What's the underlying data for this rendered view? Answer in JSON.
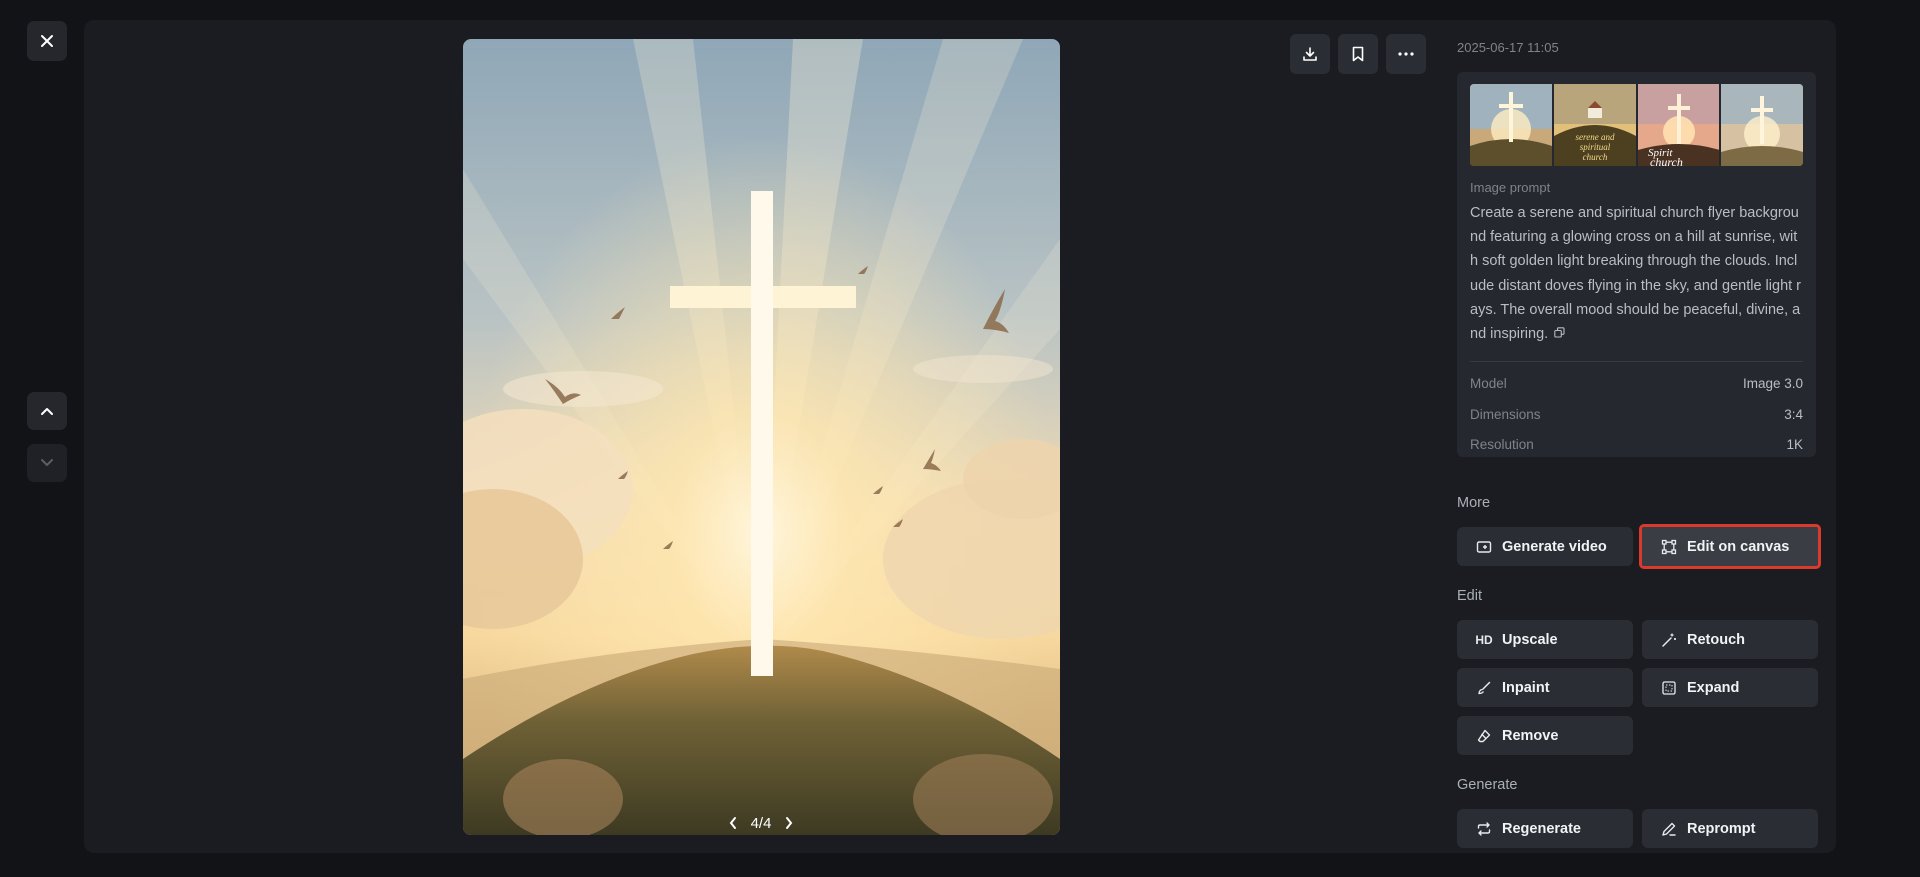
{
  "close": {
    "icon": "close-icon"
  },
  "nav": {
    "up_icon": "chevron-up-icon",
    "down_icon": "chevron-down-icon"
  },
  "viewer": {
    "pager": {
      "text": "4/4"
    },
    "thumb_texts": [
      "serene and spiritual church",
      "Spirit church"
    ]
  },
  "toolbar": {
    "download_icon": "download-icon",
    "bookmark_icon": "bookmark-icon",
    "more_icon": "more-icon"
  },
  "details": {
    "timestamp": "2025-06-17 11:05",
    "prompt_label": "Image prompt",
    "prompt_text": "Create a serene and spiritual church flyer background featuring a glowing cross on a hill at sunrise, with soft golden light breaking through the clouds. Include distant doves flying in the sky, and gentle light rays. The overall mood should be peaceful, divine, and inspiring.",
    "meta": [
      {
        "key": "Model",
        "value": "Image 3.0"
      },
      {
        "key": "Dimensions",
        "value": "3:4"
      },
      {
        "key": "Resolution",
        "value": "1K"
      }
    ]
  },
  "more": {
    "title": "More",
    "generate_video": "Generate video",
    "edit_on_canvas": "Edit on canvas"
  },
  "edit": {
    "title": "Edit",
    "upscale": "Upscale",
    "upscale_icon_text": "HD",
    "retouch": "Retouch",
    "inpaint": "Inpaint",
    "expand": "Expand",
    "remove": "Remove"
  },
  "generate": {
    "title": "Generate",
    "regenerate": "Regenerate",
    "reprompt": "Reprompt"
  },
  "colors": {
    "highlight": "#d93a2b",
    "panel": "#1a1c21",
    "button": "#2a2d33"
  }
}
